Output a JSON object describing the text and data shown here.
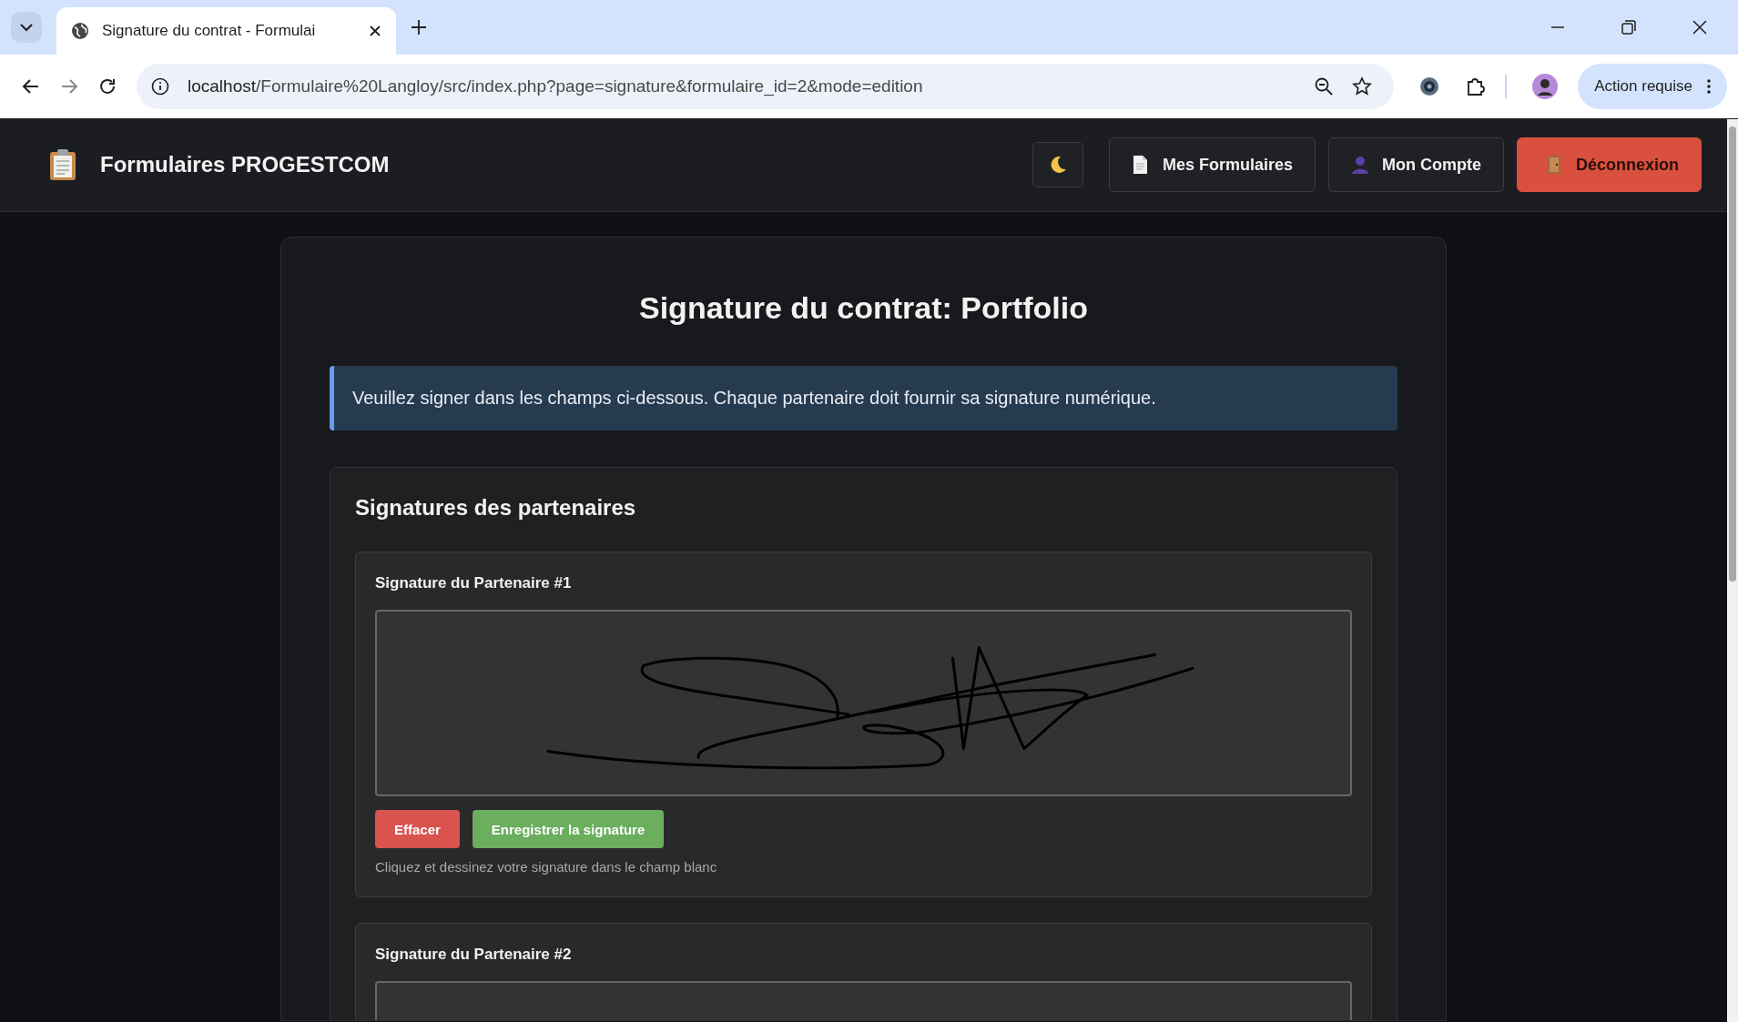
{
  "browser": {
    "tabs": [
      {
        "title": "Signature du contrat - Formulai",
        "selected": true
      }
    ],
    "url": {
      "host": "localhost",
      "path": "/Formulaire%20Langloy/src/index.php?page=signature&formulaire_id=2&mode=edition"
    },
    "profile_label": "Action requise"
  },
  "header": {
    "brand": "Formulaires PROGESTCOM",
    "nav": [
      {
        "label": "Mes Formulaires",
        "kind": "forms"
      },
      {
        "label": "Mon Compte",
        "kind": "account"
      },
      {
        "label": "Déconnexion",
        "kind": "logout"
      }
    ]
  },
  "page": {
    "title": "Signature du contrat: Portfolio",
    "info": "Veuillez signer dans les champs ci-dessous. Chaque partenaire doit fournir sa signature numérique.",
    "section_title": "Signatures des partenaires",
    "partners": [
      {
        "label": "Signature du Partenaire #1",
        "signed": true,
        "buttons": [
          {
            "label": "Effacer",
            "kind": "danger"
          },
          {
            "label": "Enregistrer la signature",
            "kind": "success"
          }
        ],
        "hint": "Cliquez et dessinez votre signature dans le champ blanc"
      },
      {
        "label": "Signature du Partenaire #2",
        "signed": false
      }
    ]
  }
}
